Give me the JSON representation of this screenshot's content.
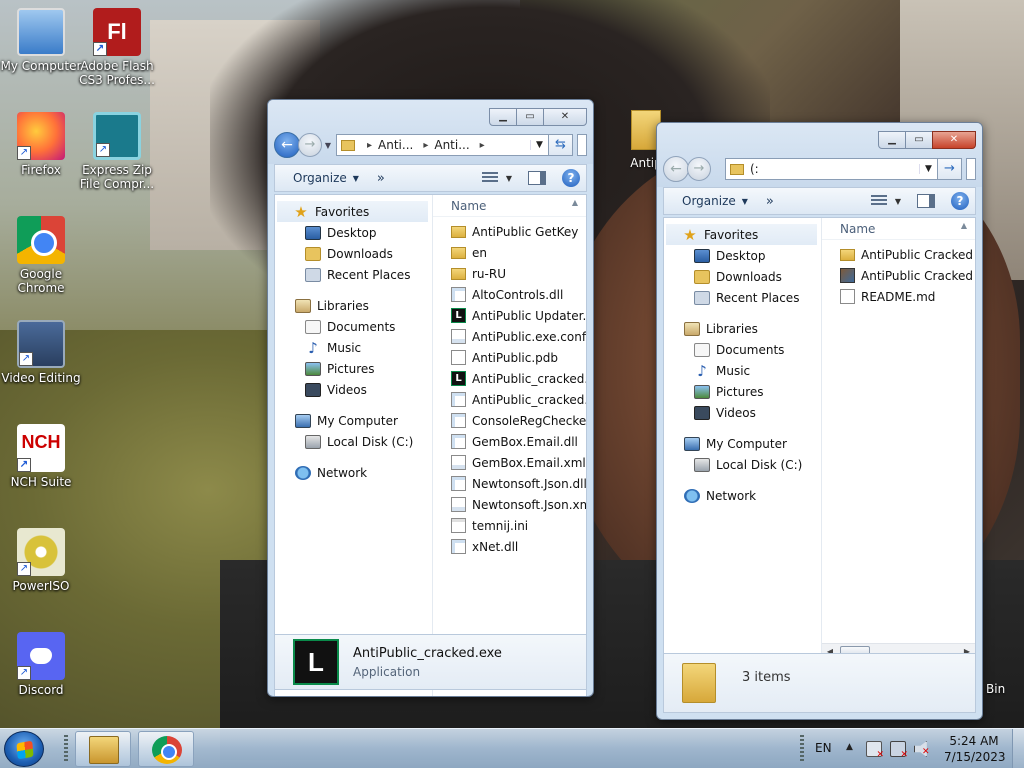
{
  "desktop": {
    "icons": [
      {
        "label": "My Computer",
        "icon": "computer-icon"
      },
      {
        "label": "Adobe Flash CS3 Profes...",
        "icon": "adobe-flash-icon",
        "glyph": "Fl"
      },
      {
        "label": "Firefox",
        "icon": "firefox-icon"
      },
      {
        "label": "Express Zip File Compr...",
        "icon": "express-zip-icon"
      },
      {
        "label": "Google Chrome",
        "icon": "chrome-icon"
      },
      {
        "label": "Video Editing",
        "icon": "video-editing-icon"
      },
      {
        "label": "NCH Suite",
        "icon": "nch-suite-icon",
        "glyph": "NCH"
      },
      {
        "label": "PowerISO",
        "icon": "poweriso-icon"
      },
      {
        "label": "Discord",
        "icon": "discord-icon"
      }
    ],
    "stray_antip_label": "Antip",
    "stray_bin_label": "Bin"
  },
  "window_left": {
    "address": {
      "crumbs": [
        "Anti...",
        "Anti..."
      ]
    },
    "toolbar": {
      "organize": "Organize",
      "more": "»"
    },
    "nav": {
      "favorites": "Favorites",
      "fav_items": [
        "Desktop",
        "Downloads",
        "Recent Places"
      ],
      "libraries": "Libraries",
      "lib_items": [
        "Documents",
        "Music",
        "Pictures",
        "Videos"
      ],
      "computer": "My Computer",
      "computer_items": [
        "Local Disk (C:)"
      ],
      "network": "Network"
    },
    "column_name": "Name",
    "files": [
      {
        "name": "AntiPublic GetKey",
        "type": "folder"
      },
      {
        "name": "en",
        "type": "folder"
      },
      {
        "name": "ru-RU",
        "type": "folder"
      },
      {
        "name": "AltoControls.dll",
        "type": "dll"
      },
      {
        "name": "AntiPublic Updater.exe",
        "type": "exe"
      },
      {
        "name": "AntiPublic.exe.config",
        "type": "xml"
      },
      {
        "name": "AntiPublic.pdb",
        "type": "doc"
      },
      {
        "name": "AntiPublic_cracked.exe",
        "type": "exe"
      },
      {
        "name": "AntiPublic_cracked.exe",
        "type": "dll"
      },
      {
        "name": "ConsoleRegChecker.exe",
        "type": "dll"
      },
      {
        "name": "GemBox.Email.dll",
        "type": "dll"
      },
      {
        "name": "GemBox.Email.xml",
        "type": "xml"
      },
      {
        "name": "Newtonsoft.Json.dll",
        "type": "dll"
      },
      {
        "name": "Newtonsoft.Json.xml",
        "type": "xml"
      },
      {
        "name": "temnij.ini",
        "type": "ini"
      },
      {
        "name": "xNet.dll",
        "type": "dll"
      }
    ],
    "details": {
      "name": "AntiPublic_cracked.exe",
      "type": "Application",
      "glyph": "L"
    }
  },
  "window_right": {
    "address": {
      "path": "(:"
    },
    "toolbar": {
      "organize": "Organize",
      "more": "»"
    },
    "nav": {
      "favorites": "Favorites",
      "fav_items": [
        "Desktop",
        "Downloads",
        "Recent Places"
      ],
      "libraries": "Libraries",
      "lib_items": [
        "Documents",
        "Music",
        "Pictures",
        "Videos"
      ],
      "computer": "My Computer",
      "computer_items": [
        "Local Disk (C:)"
      ],
      "network": "Network"
    },
    "column_name": "Name",
    "files": [
      {
        "name": "AntiPublic Cracked by",
        "type": "folder"
      },
      {
        "name": "AntiPublic Cracked by",
        "type": "rar"
      },
      {
        "name": "README.md",
        "type": "doc"
      }
    ],
    "details": {
      "count": "3 items"
    }
  },
  "taskbar": {
    "language": "EN",
    "time": "5:24 AM",
    "date": "7/15/2023"
  }
}
